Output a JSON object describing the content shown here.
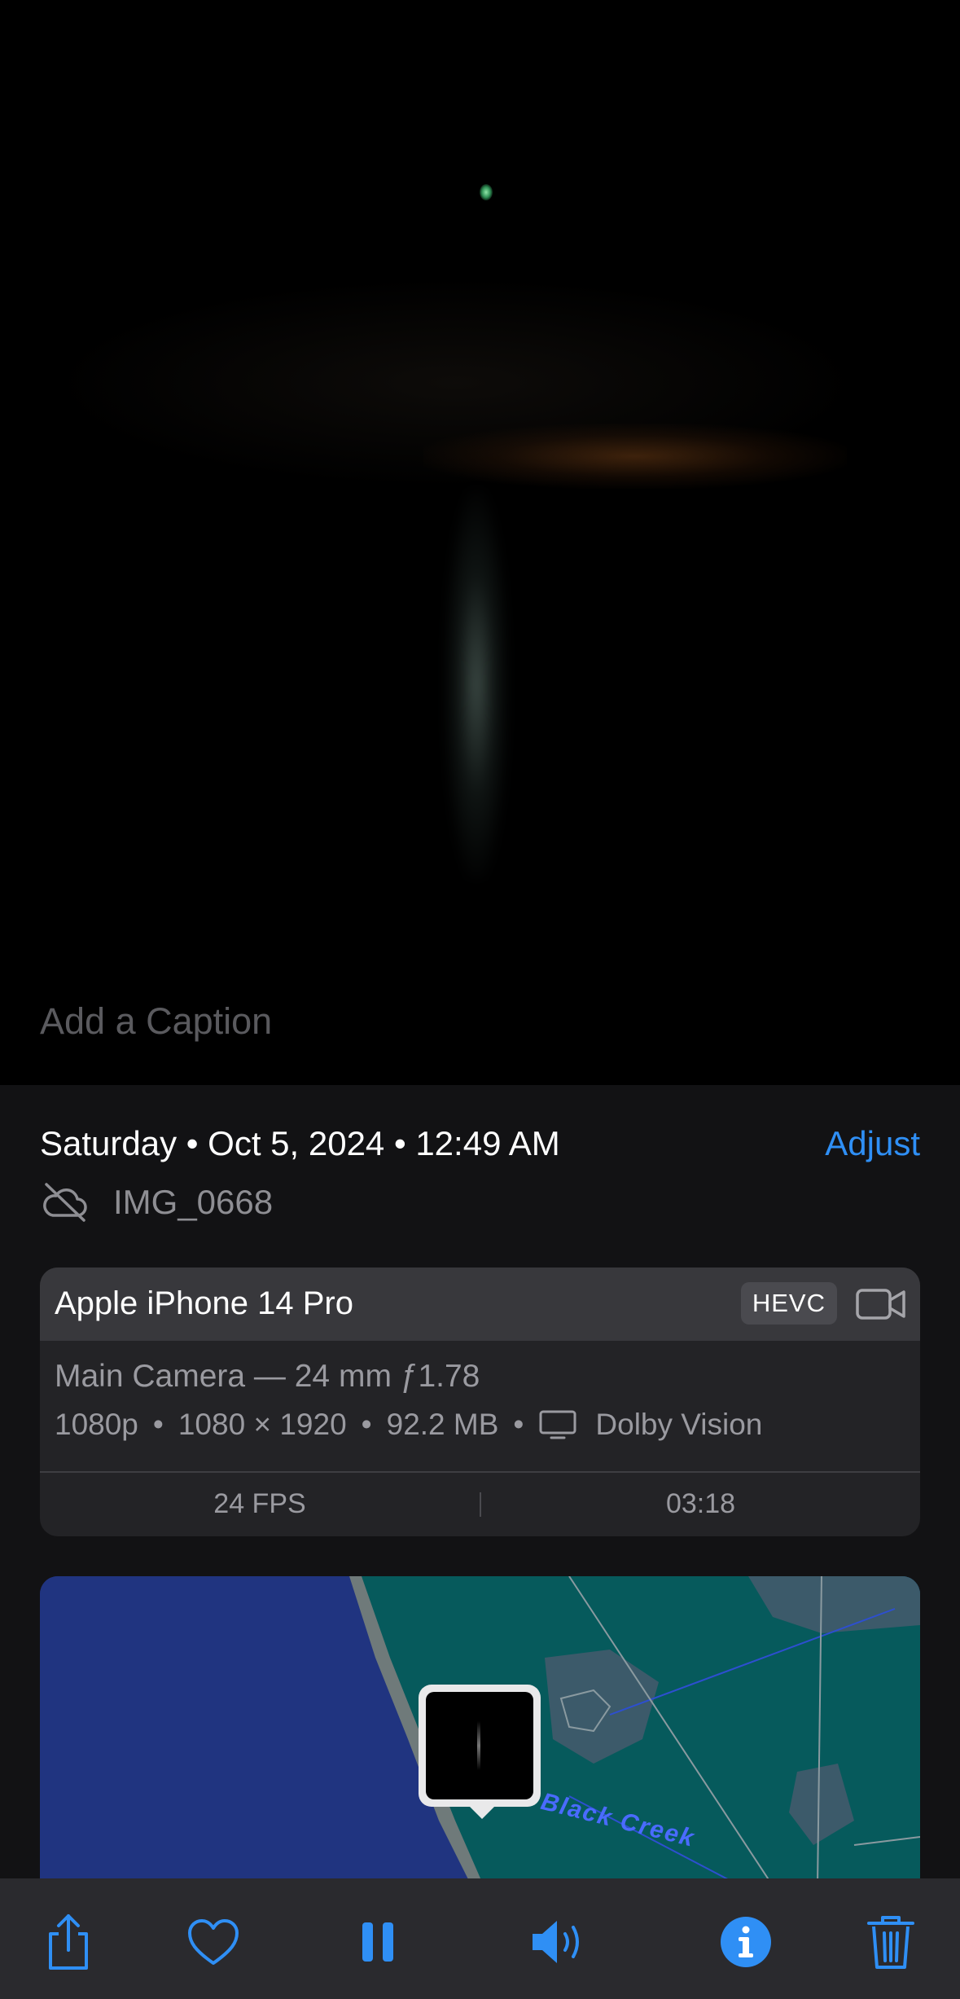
{
  "caption": {
    "placeholder": "Add a Caption"
  },
  "details": {
    "date_line": "Saturday • Oct 5, 2024 • 12:49 AM",
    "adjust_label": "Adjust",
    "filename": "IMG_0668"
  },
  "device_card": {
    "device": "Apple iPhone 14 Pro",
    "codec": "HEVC",
    "camera": "Main Camera — 24 mm ƒ1.78",
    "resolution": "1080p",
    "dimensions": "1080 × 1920",
    "size": "92.2 MB",
    "hdr": "Dolby Vision",
    "fps": "24 FPS",
    "duration": "03:18"
  },
  "map": {
    "label": "Black Creek"
  },
  "toolbar": {
    "items": [
      "share-icon",
      "heart-icon",
      "pause-icon",
      "volume-icon",
      "info-icon",
      "trash-icon"
    ],
    "accent": "#2f8ff5"
  }
}
